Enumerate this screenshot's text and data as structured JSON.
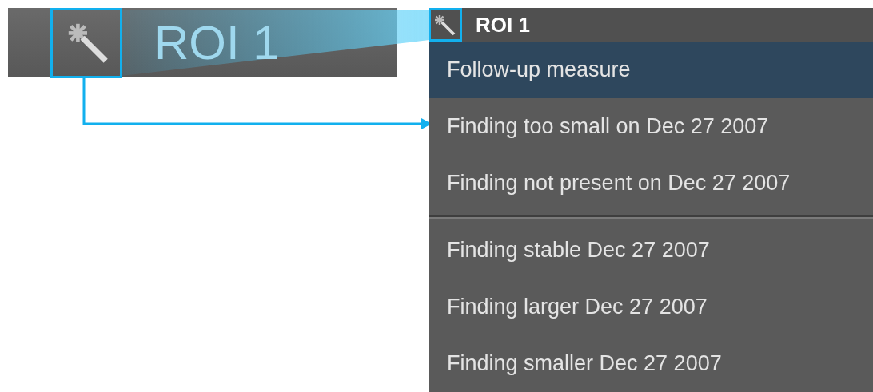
{
  "preview": {
    "label": "ROI 1"
  },
  "menu": {
    "header": "ROI 1",
    "items": [
      {
        "kind": "item",
        "label": "Follow-up measure",
        "selected": true
      },
      {
        "kind": "item",
        "label": "Finding too small on Dec 27 2007",
        "selected": false
      },
      {
        "kind": "item",
        "label": "Finding not present on Dec 27 2007",
        "selected": false
      },
      {
        "kind": "separator"
      },
      {
        "kind": "item",
        "label": "Finding stable Dec 27 2007",
        "selected": false
      },
      {
        "kind": "item",
        "label": "Finding larger Dec 27 2007",
        "selected": false
      },
      {
        "kind": "item",
        "label": "Finding smaller Dec 27 2007",
        "selected": false
      }
    ]
  }
}
